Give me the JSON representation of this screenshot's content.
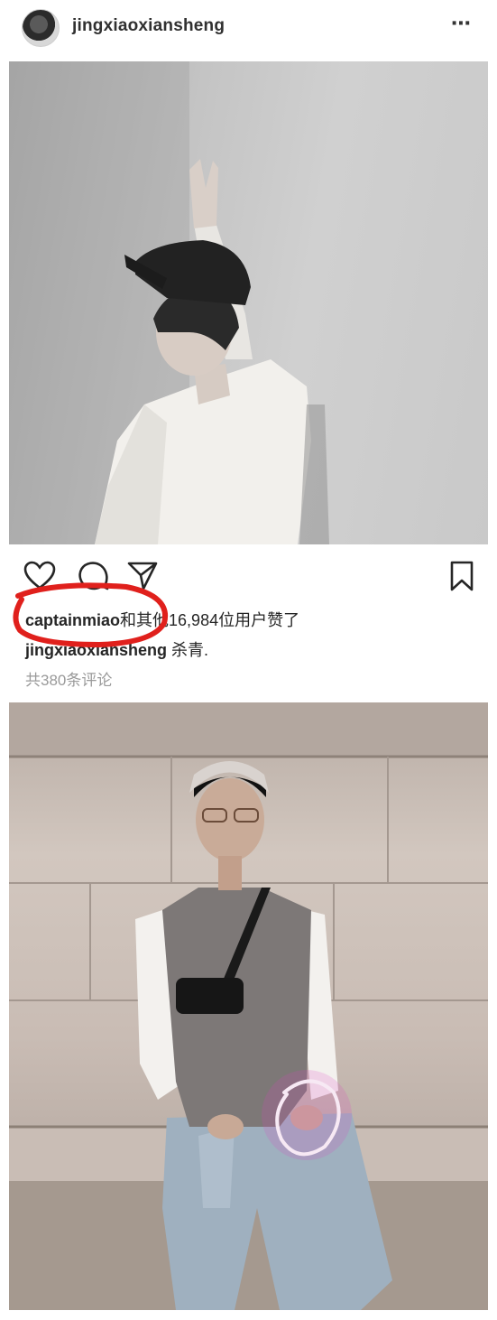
{
  "post": {
    "username": "jingxiaoxiansheng",
    "more_icon": "⋯",
    "liked_by_user": "captainmiao",
    "likes_text": "和其他16,984位用户赞了",
    "caption_user": "jingxiaoxiansheng",
    "caption_text": " 杀青.",
    "comments_link": "共380条评论"
  },
  "icons": [
    "heart-icon",
    "comment-icon",
    "share-icon",
    "bookmark-icon",
    "more-icon"
  ],
  "colors": {
    "annotation_red": "#e0201c",
    "annotation_pink": "#e040c0"
  }
}
